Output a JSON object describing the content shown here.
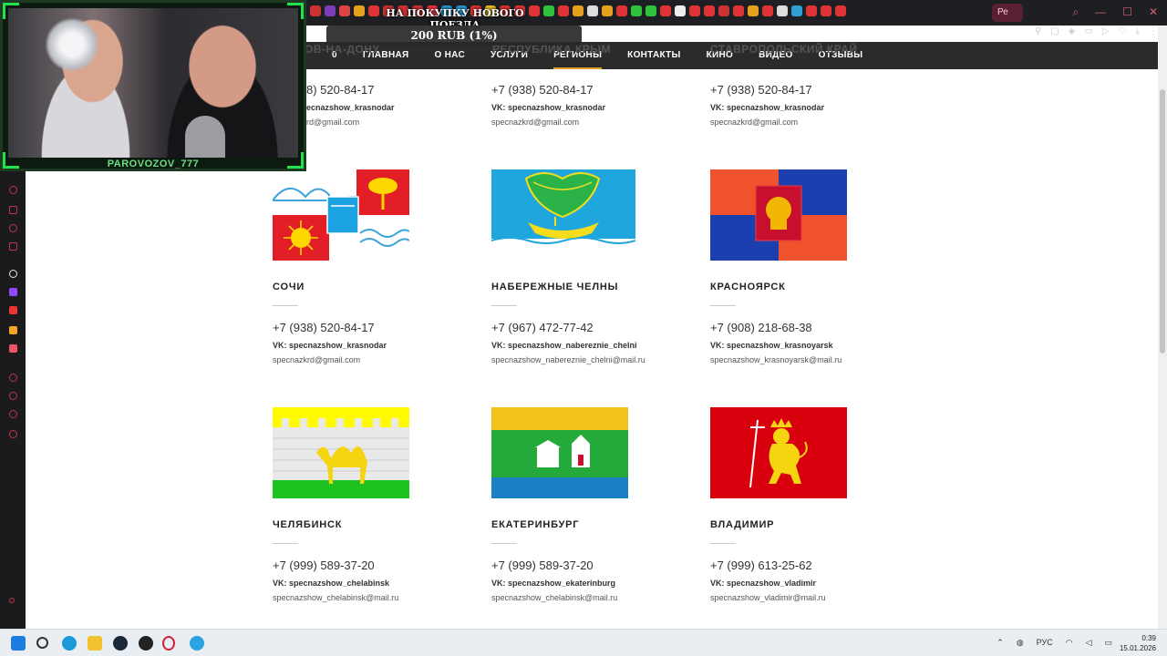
{
  "overlay": {
    "donation_title": "НА ПОКУПКУ НОВОГО ПОЕЗДА",
    "donation_amount": "200 RUB (1%)",
    "streamer_name": "PAROVOZOV_777"
  },
  "browser": {
    "active_tab_label": "Ре"
  },
  "nav": {
    "items": [
      {
        "label": "0"
      },
      {
        "label": "ГЛАВНАЯ"
      },
      {
        "label": "О НАС"
      },
      {
        "label": "УСЛУГИ"
      },
      {
        "label": "РЕГИОНЫ"
      },
      {
        "label": "КОНТАКТЫ"
      },
      {
        "label": "КИНО"
      },
      {
        "label": "ВИДЕО"
      },
      {
        "label": "ОТЗЫВЫ"
      }
    ],
    "active": "РЕГИОНЫ",
    "accent": "#e0a020"
  },
  "partial_headings": [
    "ОВ-НА-ДОНУ",
    "РЕСПУБЛИКА КРЫМ",
    "СТАВРОПОЛЬСКИЙ КРАЙ"
  ],
  "partial_row": [
    {
      "phone": "8) 520-84-17",
      "vk": "ecnazshow_krasnodar",
      "email": "rd@gmail.com"
    },
    {
      "phone": "+7 (938) 520-84-17",
      "vk": "VK: specnazshow_krasnodar",
      "email": "specnazkrd@gmail.com"
    },
    {
      "phone": "+7 (938) 520-84-17",
      "vk": "VK: specnazshow_krasnodar",
      "email": "specnazkrd@gmail.com"
    }
  ],
  "regions": [
    {
      "city": "СОЧИ",
      "phone": "+7 (938) 520-84-17",
      "vk": "VK: specnazshow_krasnodar",
      "email": "specnazkrd@gmail.com",
      "flag": "sochi-flag"
    },
    {
      "city": "НАБЕРЕЖНЫЕ ЧЕЛНЫ",
      "phone": "+7 (967) 472-77-42",
      "vk": "VK: specnazshow_nabereznie_chelni",
      "email": "specnazshow_nabereznie_chelni@mail.ru",
      "flag": "naberezhnye-chelny-flag"
    },
    {
      "city": "КРАСНОЯРСК",
      "phone": "+7 (908) 218-68-38",
      "vk": "VK: specnazshow_krasnoyarsk",
      "email": "specnazshow_krasnoyarsk@mail.ru",
      "flag": "krasnoyarsk-flag"
    },
    {
      "city": "ЧЕЛЯБИНСК",
      "phone": "+7 (999) 589-37-20",
      "vk": "VK: specnazshow_chelabinsk",
      "email": "specnazshow_chelabinsk@mail.ru",
      "flag": "chelyabinsk-flag"
    },
    {
      "city": "ЕКАТЕРИНБУРГ",
      "phone": "+7 (999) 589-37-20",
      "vk": "VK: specnazshow_ekaterinburg",
      "email": "specnazshow_chelabinsk@mail.ru",
      "flag": "yekaterinburg-flag"
    },
    {
      "city": "ВЛАДИМИР",
      "phone": "+7 (999) 613-25-62",
      "vk": "VK: specnazshow_vladimir",
      "email": "specnazshow_vladimir@mail.ru",
      "flag": "vladimir-flag"
    }
  ],
  "taskbar": {
    "lang": "РУС",
    "time": "0:39",
    "date": "15.01.2026"
  }
}
